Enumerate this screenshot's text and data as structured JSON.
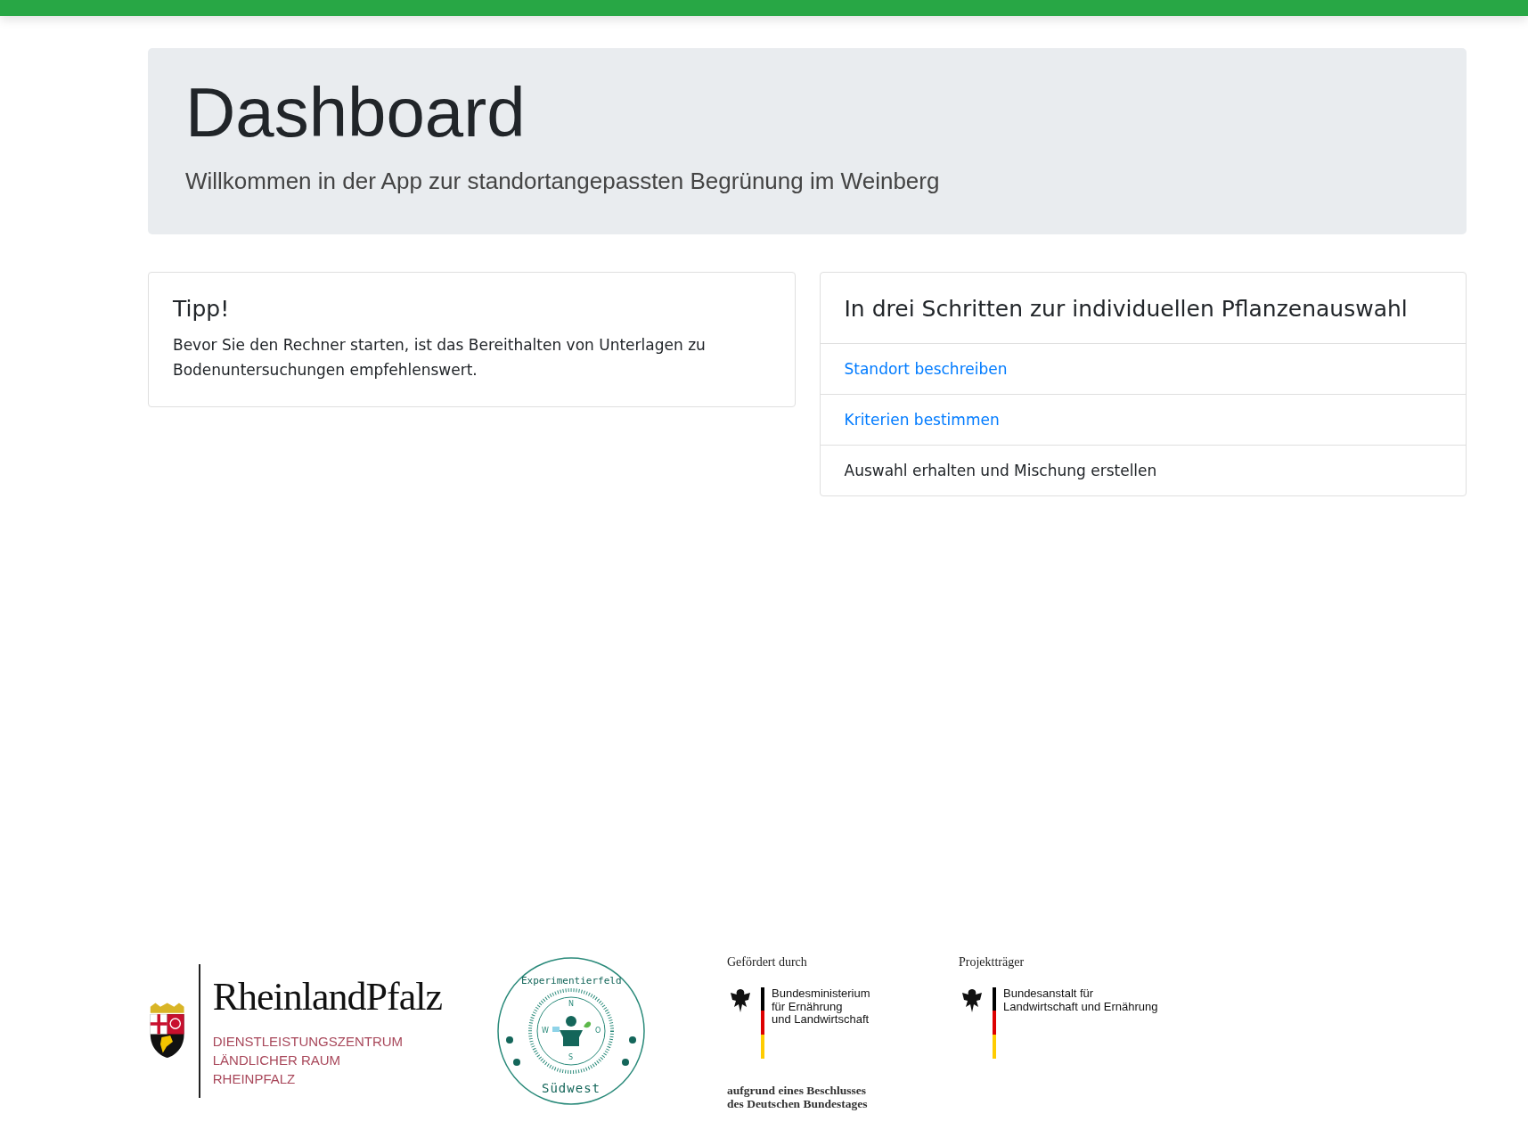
{
  "header": {
    "title": "Dashboard",
    "subtitle": "Willkommen in der App zur standortangepassten Begrünung im Weinberg"
  },
  "tip": {
    "title": "Tipp!",
    "text": "Bevor Sie den Rechner starten, ist das Bereithalten von Unterlagen zu Bodenuntersuchungen empfehlenswert."
  },
  "steps": {
    "title": "In drei Schritten zur individuellen Pflanzenauswahl",
    "items": [
      {
        "label": "Standort beschreiben",
        "kind": "link"
      },
      {
        "label": "Kriterien bestimmen",
        "kind": "link"
      },
      {
        "label": "Auswahl erhalten und Mischung erstellen",
        "kind": "text"
      }
    ]
  },
  "footer_logos": {
    "rlp": {
      "name": "RheinlandPfalz",
      "lines": [
        "DIENSTLEISTUNGSZENTRUM",
        "LÄNDLICHER RAUM",
        "RHEINPFALZ"
      ]
    },
    "experimentierfeld": {
      "top": "Experimentierfeld",
      "bottom": "Südwest",
      "compass": [
        "N",
        "W",
        "O",
        "S"
      ]
    },
    "funding": {
      "caption": "Gefördert durch",
      "lines": [
        "Bundesministerium",
        "für Ernährung",
        "und Landwirtschaft"
      ],
      "note": [
        "aufgrund eines Beschlusses",
        "des Deutschen Bundestages"
      ]
    },
    "sponsor": {
      "caption": "Projektträger",
      "lines": [
        "Bundesanstalt für",
        "Landwirtschaft und Ernährung"
      ]
    }
  }
}
